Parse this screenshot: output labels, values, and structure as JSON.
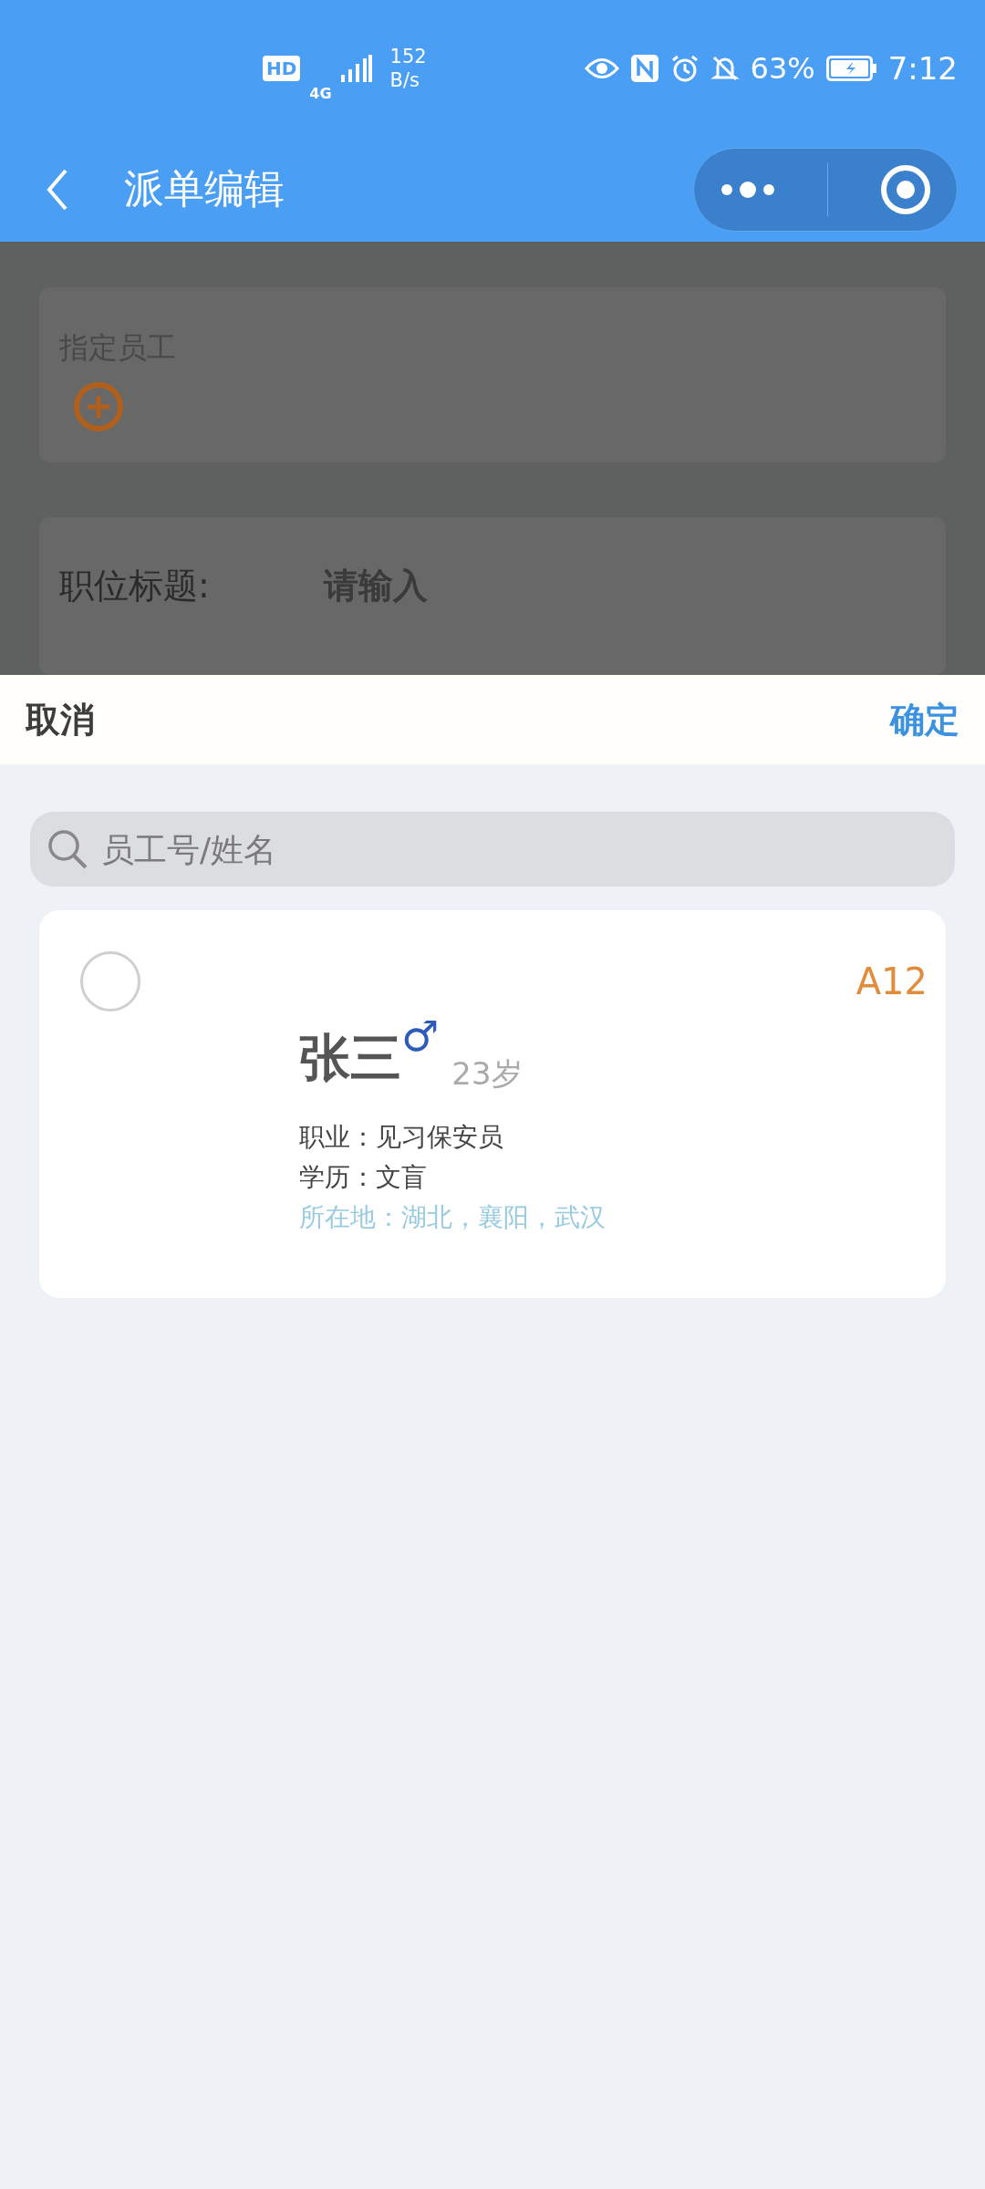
{
  "status_bar": {
    "network_badge": "HD",
    "network_type": "4G",
    "speed_value": "152",
    "speed_unit": "B/s",
    "battery": "63%",
    "time": "7:12"
  },
  "nav_bar": {
    "title": "派单编辑"
  },
  "background_form": {
    "assign_label": "指定员工",
    "title_label": "职位标题:",
    "title_placeholder": "请输入"
  },
  "sheet": {
    "cancel": "取消",
    "confirm": "确定",
    "search": {
      "placeholder": "员工号/姓名"
    },
    "employees": [
      {
        "selected": false,
        "code": "A12",
        "name": "张三",
        "gender_symbol": "♂",
        "age": "23岁",
        "occupation": "职业：见习保安员",
        "education": "学历：文盲",
        "location": "所在地：湖北，襄阳，武汉"
      }
    ]
  }
}
